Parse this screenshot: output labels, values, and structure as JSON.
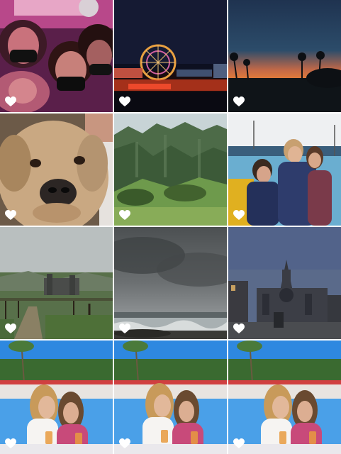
{
  "gallery": {
    "photos": [
      {
        "id": 1,
        "subject": "selfie-masks-night",
        "favorite": true
      },
      {
        "id": 2,
        "subject": "ferris-wheel-night",
        "favorite": true
      },
      {
        "id": 3,
        "subject": "palm-trees-sunset",
        "favorite": true
      },
      {
        "id": 4,
        "subject": "dog-closeup",
        "favorite": true
      },
      {
        "id": 5,
        "subject": "green-mountains",
        "favorite": true
      },
      {
        "id": 6,
        "subject": "friends-pool",
        "favorite": true
      },
      {
        "id": 7,
        "subject": "castle-countryside",
        "favorite": true
      },
      {
        "id": 8,
        "subject": "stormy-sea",
        "favorite": true
      },
      {
        "id": 9,
        "subject": "cathedral-dusk",
        "favorite": true
      },
      {
        "id": 10,
        "subject": "friends-cafe-1",
        "favorite": true
      },
      {
        "id": 11,
        "subject": "friends-cafe-2",
        "favorite": true
      },
      {
        "id": 12,
        "subject": "friends-cafe-3",
        "favorite": true
      }
    ],
    "favorite_icon": "heart-icon"
  },
  "colors": {
    "heart": "#ffffff",
    "gap": "#ffffff"
  }
}
